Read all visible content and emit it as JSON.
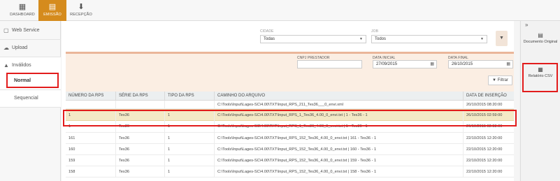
{
  "topnav": [
    {
      "icon": "dashboard-icon",
      "label": "DASHBOARD",
      "glyph": "▦"
    },
    {
      "icon": "document-icon",
      "label": "EMISSÃO",
      "glyph": "▤"
    },
    {
      "icon": "download-icon",
      "label": "RECEPÇÃO",
      "glyph": "⬇"
    }
  ],
  "sidebar": {
    "items": [
      {
        "icon": "file-icon",
        "glyph": "▢",
        "label": "Web Service"
      },
      {
        "icon": "upload-icon",
        "glyph": "☁",
        "label": "Upload"
      },
      {
        "icon": "warning-icon",
        "glyph": "▲",
        "label": "Inválidos"
      }
    ],
    "subitems": [
      {
        "label": "Normal"
      },
      {
        "label": "Sequencial"
      }
    ]
  },
  "filters": {
    "cidade_label": "CIDADE",
    "cidade_value": "Todas",
    "job_label": "JOB",
    "job_value": "Todos",
    "cnpj_label": "CNPJ PRESTADOR",
    "cnpj_value": "",
    "data_inicial_label": "DATA INICIAL",
    "data_inicial_value": "27/09/2015",
    "data_final_label": "DATA FINAL",
    "data_final_value": "26/10/2015",
    "filtrar_label": "Filtrar"
  },
  "table": {
    "headers": [
      "NÚMERO DA RPS",
      "SÉRIE DA RPS",
      "TIPO DA RPS",
      "CAMINHO DO ARQUIVO",
      "DATA DE INSERÇÃO"
    ],
    "rows": [
      [
        "",
        "",
        "",
        "C:\\Tools\\Input\\Lages-SC\\4.00\\TXT\\Input_RPS_211_Tes36___0_envi.xml",
        "20/10/2015 08:20:00"
      ],
      [
        "1",
        "Tes36",
        "1",
        "C:\\Tools\\Input\\Lages-SC\\4.00\\TXT\\Input_RPS_1_Tes36_4.00_0_envi.txt | 1 - Tes36 - 1",
        "26/10/2015 02:59:00"
      ],
      [
        "1",
        "Tes36",
        "1",
        "C:\\Tools\\Input\\Lages-SC\\4.00\\TXT\\Input_RPS_1_Tes36_4.00_0_envi.txt | 1 - Tes36 - 1",
        "26/10/2015 02:58:00"
      ],
      [
        "161",
        "Tes36",
        "1",
        "C:\\Tools\\Input\\Lages-SC\\4.00\\TXT\\Input_RPS_152_Tes36_4.00_0_envi.txt | 161 - Tes36 - 1",
        "22/10/2015 12:20:00"
      ],
      [
        "160",
        "Tes36",
        "1",
        "C:\\Tools\\Input\\Lages-SC\\4.00\\TXT\\Input_RPS_152_Tes36_4.00_0_envi.txt | 160 - Tes36 - 1",
        "22/10/2015 12:20:00"
      ],
      [
        "159",
        "Tes36",
        "1",
        "C:\\Tools\\Input\\Lages-SC\\4.00\\TXT\\Input_RPS_152_Tes36_4.00_0_envi.txt | 159 - Tes36 - 1",
        "22/10/2015 12:20:00"
      ],
      [
        "158",
        "Tes36",
        "1",
        "C:\\Tools\\Input\\Lages-SC\\4.00\\TXT\\Input_RPS_152_Tes36_4.00_0_envi.txt | 158 - Tes36 - 1",
        "22/10/2015 12:20:00"
      ]
    ]
  },
  "right_panel": {
    "documento_label": "Documento Original",
    "relatorio_label": "Relatório CSV",
    "collapse_glyph": "»"
  },
  "colors": {
    "accent": "#d58b1d",
    "highlight_box": "#e21c1c",
    "selected_row": "#f4e9c6"
  }
}
